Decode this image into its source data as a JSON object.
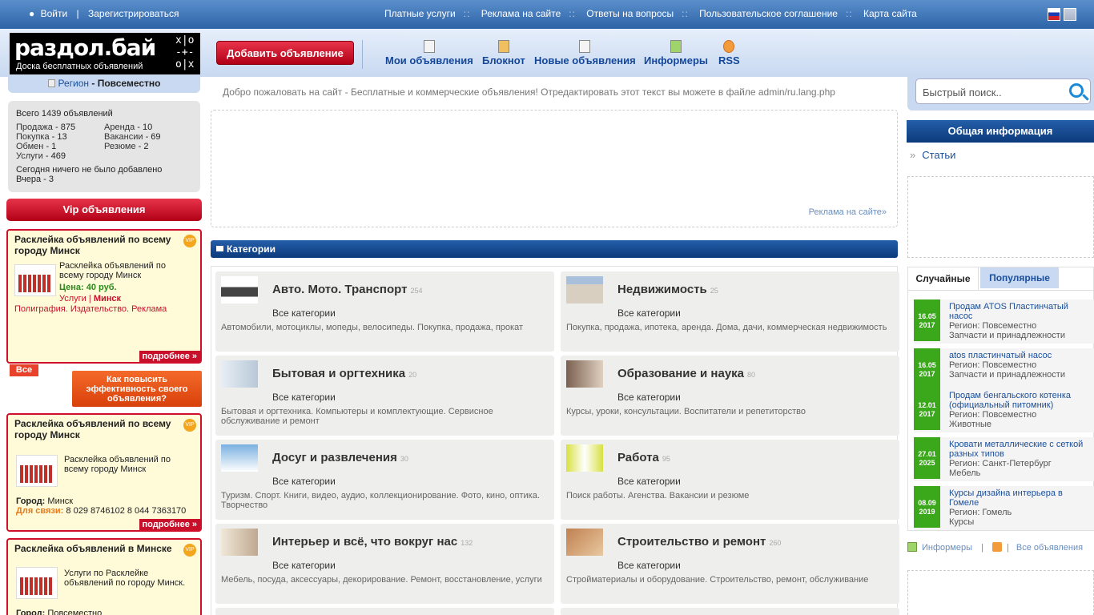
{
  "topbar": {
    "login": "Войти",
    "register": "Зарегистрироваться",
    "menu": [
      "Платные услуги",
      "Реклама на сайте",
      "Ответы на вопросы",
      "Пользовательское соглашение",
      "Карта сайта"
    ],
    "separator": "::"
  },
  "logo": {
    "name": "раздол.бай",
    "tagline": "Доска бесплатных объявлений"
  },
  "header": {
    "add_button": "Добавить объявление",
    "nav": [
      {
        "label": "Мои объявления",
        "icon": "documents-icon"
      },
      {
        "label": "Блокнот",
        "icon": "notepad-icon"
      },
      {
        "label": "Новые объявления",
        "icon": "new-page-icon"
      },
      {
        "label": "Информеры",
        "icon": "informer-icon"
      },
      {
        "label": "RSS",
        "icon": "rss-icon"
      }
    ]
  },
  "region": {
    "label": "Регион",
    "value": "- Повсеместно"
  },
  "stats": {
    "total": "Всего 1439 объявлений",
    "left": [
      {
        "label": "Продажа",
        "count": "- 875"
      },
      {
        "label": "Покупка",
        "count": "- 13"
      },
      {
        "label": "Обмен",
        "count": "- 1"
      },
      {
        "label": "Услуги",
        "count": "- 469"
      }
    ],
    "right": [
      {
        "label": "Аренда",
        "count": "- 10"
      },
      {
        "label": "Вакансии",
        "count": "- 69"
      },
      {
        "label": "Резюме",
        "count": "- 2"
      }
    ],
    "today": "Сегодня ничего не было добавлено",
    "yesterday": "Вчера - 3"
  },
  "vip": {
    "title": "Vip объявления",
    "badge": "VIP",
    "more": "подробнее »",
    "all": "Все",
    "how": "Как повысить эффективность своего объявления?",
    "ads": [
      {
        "title": "Расклейка объявлений по всему городу Минск",
        "text": "Расклейка объявлений по всему городу Минск",
        "price": "Цена: 40 руб.",
        "category": "Услуги",
        "city": "Минск",
        "subcategory": "Полиграфия. Издательство. Реклама"
      },
      {
        "title": "Расклейка объявлений по всему городу Минск",
        "text": "Расклейка объявлений по всему городу Минск",
        "city_label": "Город:",
        "city": "Минск",
        "contact_label": "Для связи:",
        "contact": "8 029 8746102 8 044 7363170"
      },
      {
        "title": "Расклейка объявлений в Минске",
        "text": "Услуги по Расклейке объявлений по городу Минск.",
        "city_label": "Город:",
        "city": "Повсеместно"
      }
    ]
  },
  "main": {
    "welcome": "Добро пожаловать на сайт - Бесплатные и коммерческие объявления! Отредактировать этот текст вы можете в файле admin/ru.lang.php",
    "ad_link": "Реклама на сайте»",
    "categories_title": "Категории",
    "all_label": "Все категории",
    "categories": [
      {
        "title": "Авто. Мото. Транспорт",
        "count": "254",
        "desc": "Автомобили, мотоциклы, мопеды, велосипеды. Покупка, продажа, прокат"
      },
      {
        "title": "Недвижимость",
        "count": "25",
        "desc": "Покупка, продажа, ипотека, аренда. Дома, дачи, коммерческая недвижимость"
      },
      {
        "title": "Бытовая и оргтехника",
        "count": "20",
        "desc": "Бытовая и оргтехника. Компьютеры и комплектующие. Сервисное обслуживание и ремонт"
      },
      {
        "title": "Образование и наука",
        "count": "80",
        "desc": "Курсы, уроки, консультации. Воспитатели и репетиторство"
      },
      {
        "title": "Досуг и развлечения",
        "count": "30",
        "desc": "Туризм. Спорт. Книги, видео, аудио, коллекционирование. Фото, кино, оптика. Творчество"
      },
      {
        "title": "Работа",
        "count": "95",
        "desc": "Поиск работы. Агенства. Вакансии и резюме"
      },
      {
        "title": "Интерьер и всё, что вокруг нас",
        "count": "132",
        "desc": "Мебель, посуда, аксессуары, декорирование. Ремонт, восстановление, услуги"
      },
      {
        "title": "Строительство и ремонт",
        "count": "260",
        "desc": "Стройматериалы и оборудование. Строительство, ремонт, обслуживание"
      }
    ]
  },
  "sidebar": {
    "search_placeholder": "Быстрый поиск..",
    "info_title": "Общая информация",
    "articles": "Статьи",
    "articles_bullet": "»",
    "tab_random": "Случайные",
    "tab_popular": "Популярные",
    "items": [
      {
        "day": "16.05",
        "year": "2017",
        "title": "Продам ATOS Пластинчатый насос",
        "region": "Регион: Повсеместно",
        "cat": "Запчасти и принадлежности"
      },
      {
        "day": "16.05",
        "year": "2017",
        "title": "atos пластинчатый насос",
        "region": "Регион: Повсеместно",
        "cat": "Запчасти и принадлежности"
      },
      {
        "day": "12.01",
        "year": "2017",
        "title": "Продам бенгальского котенка (официальный питомник)",
        "region": "Регион: Повсеместно",
        "cat": "Животные"
      },
      {
        "day": "27.01",
        "year": "2025",
        "title": "Кровати металлические с сеткой разных типов",
        "region": "Регион: Санкт-Петербург",
        "cat": "Мебель"
      },
      {
        "day": "08.09",
        "year": "2019",
        "title": "Курсы дизайна интерьера в Гомеле",
        "region": "Регион: Гомель",
        "cat": "Курсы"
      }
    ],
    "informers": "Информеры",
    "all_ads": "Все объявления",
    "pipe": "|"
  },
  "colors": {
    "accent": "#2d64a8",
    "red": "#c8102a",
    "green": "#3aa81a"
  }
}
